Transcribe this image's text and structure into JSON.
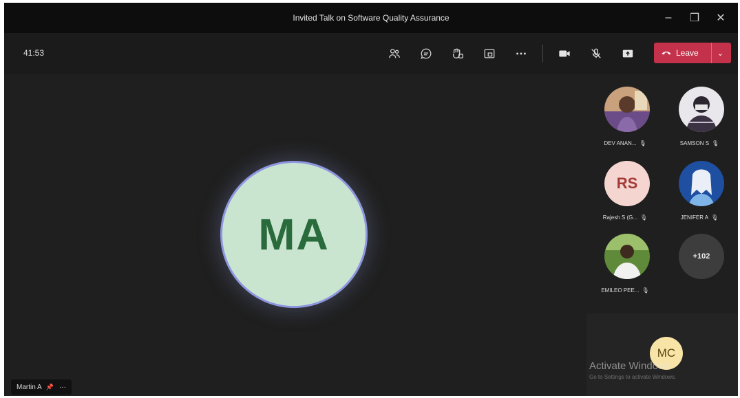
{
  "window": {
    "title": "Invited Talk on Software Quality Assurance",
    "minimize": "–",
    "maximize": "❐",
    "close": "✕"
  },
  "toolbar": {
    "timer": "41:53",
    "leave_label": "Leave",
    "tools": [
      "people-icon",
      "chat-icon",
      "reactions-icon",
      "share-tray-icon",
      "more-icon",
      "camera-icon",
      "mic-off-icon",
      "share-screen-icon"
    ],
    "leave_color": "#c4314b"
  },
  "stage": {
    "main_initials": "MA",
    "main_avatar_color": "#c9e5d0",
    "main_text_color": "#2a6b3c"
  },
  "name_tag": {
    "name": "Martin A",
    "more": "···"
  },
  "participants": [
    {
      "label": "DEV ANAN...",
      "type": "photo"
    },
    {
      "label": "SAMSON S",
      "type": "photo"
    },
    {
      "label": "Rajesh S (G...",
      "initials": "RS",
      "type": "initials"
    },
    {
      "label": "JENIFER A",
      "type": "photo"
    },
    {
      "label": "EMILEO PEE...",
      "type": "photo"
    },
    {
      "label": "",
      "count": "+102",
      "type": "overflow"
    }
  ],
  "self_view": {
    "initials": "MC"
  },
  "watermark": {
    "line1": "Activate Windows",
    "line2": "Go to Settings to activate Windows."
  }
}
